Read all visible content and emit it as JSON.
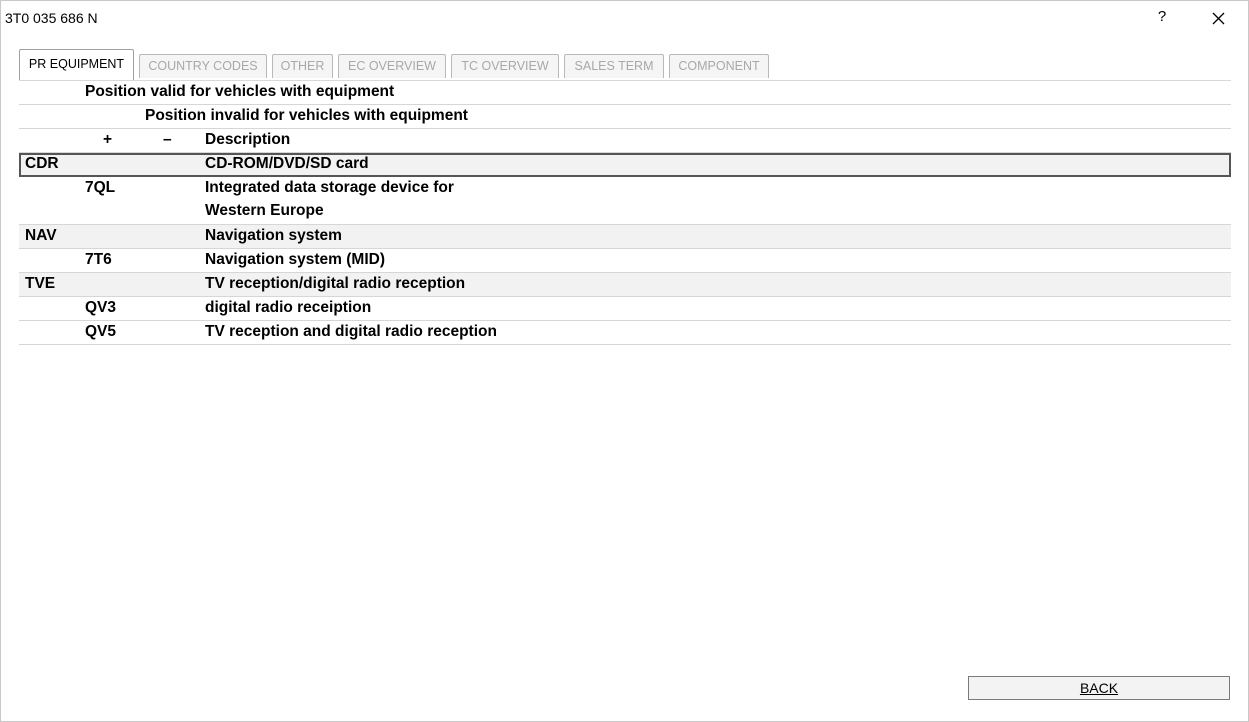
{
  "window": {
    "title": "3T0 035 686 N",
    "help_label": "?",
    "close_icon": "close-icon"
  },
  "tabs": [
    {
      "label": "PR EQUIPMENT",
      "active": true
    },
    {
      "label": "COUNTRY CODES",
      "active": false
    },
    {
      "label": "OTHER",
      "active": false
    },
    {
      "label": "EC OVERVIEW",
      "active": false
    },
    {
      "label": "TC OVERVIEW",
      "active": false
    },
    {
      "label": "SALES TERM",
      "active": false
    },
    {
      "label": "COMPONENT",
      "active": false
    }
  ],
  "table": {
    "header_valid": "Position valid for vehicles with equipment",
    "header_invalid": "Position invalid for vehicles with equipment",
    "header_plus": "+",
    "header_minus": "–",
    "header_description": "Description",
    "rows": [
      {
        "code": "CDR",
        "sub": "",
        "description": "CD-ROM/DVD/SD card",
        "selected": true
      },
      {
        "code": "",
        "sub": "7QL",
        "description": "Integrated data storage device for",
        "description_line2": "Western Europe"
      },
      {
        "code": "NAV",
        "sub": "",
        "description": "Navigation system"
      },
      {
        "code": "",
        "sub": "7T6",
        "description": "Navigation system (MID)"
      },
      {
        "code": "TVE",
        "sub": "",
        "description": "TV reception/digital radio reception"
      },
      {
        "code": "",
        "sub": "QV3",
        "description": "digital radio receiption"
      },
      {
        "code": "",
        "sub": "QV5",
        "description": "TV reception and digital radio reception"
      }
    ]
  },
  "footer": {
    "back_label": "BACK"
  }
}
